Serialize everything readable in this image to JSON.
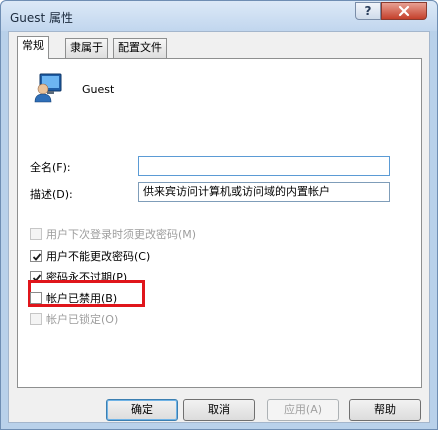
{
  "window": {
    "title": "Guest 属性",
    "help_label": "?"
  },
  "tabs": [
    {
      "label": "常规",
      "active": true
    },
    {
      "label": "隶属于",
      "active": false
    },
    {
      "label": "配置文件",
      "active": false
    }
  ],
  "general": {
    "user_name": "Guest",
    "fullname_label": "全名(F):",
    "fullname_value": "",
    "description_label": "描述(D):",
    "description_value": "供来宾访问计算机或访问域的内置帐户"
  },
  "options": [
    {
      "label": "用户下次登录时须更改密码(M)",
      "checked": false,
      "disabled": true
    },
    {
      "label": "用户不能更改密码(C)",
      "checked": true,
      "disabled": false
    },
    {
      "label": "密码永不过期(P)",
      "checked": true,
      "disabled": false
    },
    {
      "label": "帐户已禁用(B)",
      "checked": false,
      "disabled": false
    },
    {
      "label": "帐户已锁定(O)",
      "checked": false,
      "disabled": true
    }
  ],
  "buttons": {
    "ok": "确定",
    "cancel": "取消",
    "apply": "应用(A)",
    "help": "帮助"
  },
  "colors": {
    "highlight": "#e0151b",
    "accent_border": "#5b9bd5"
  }
}
